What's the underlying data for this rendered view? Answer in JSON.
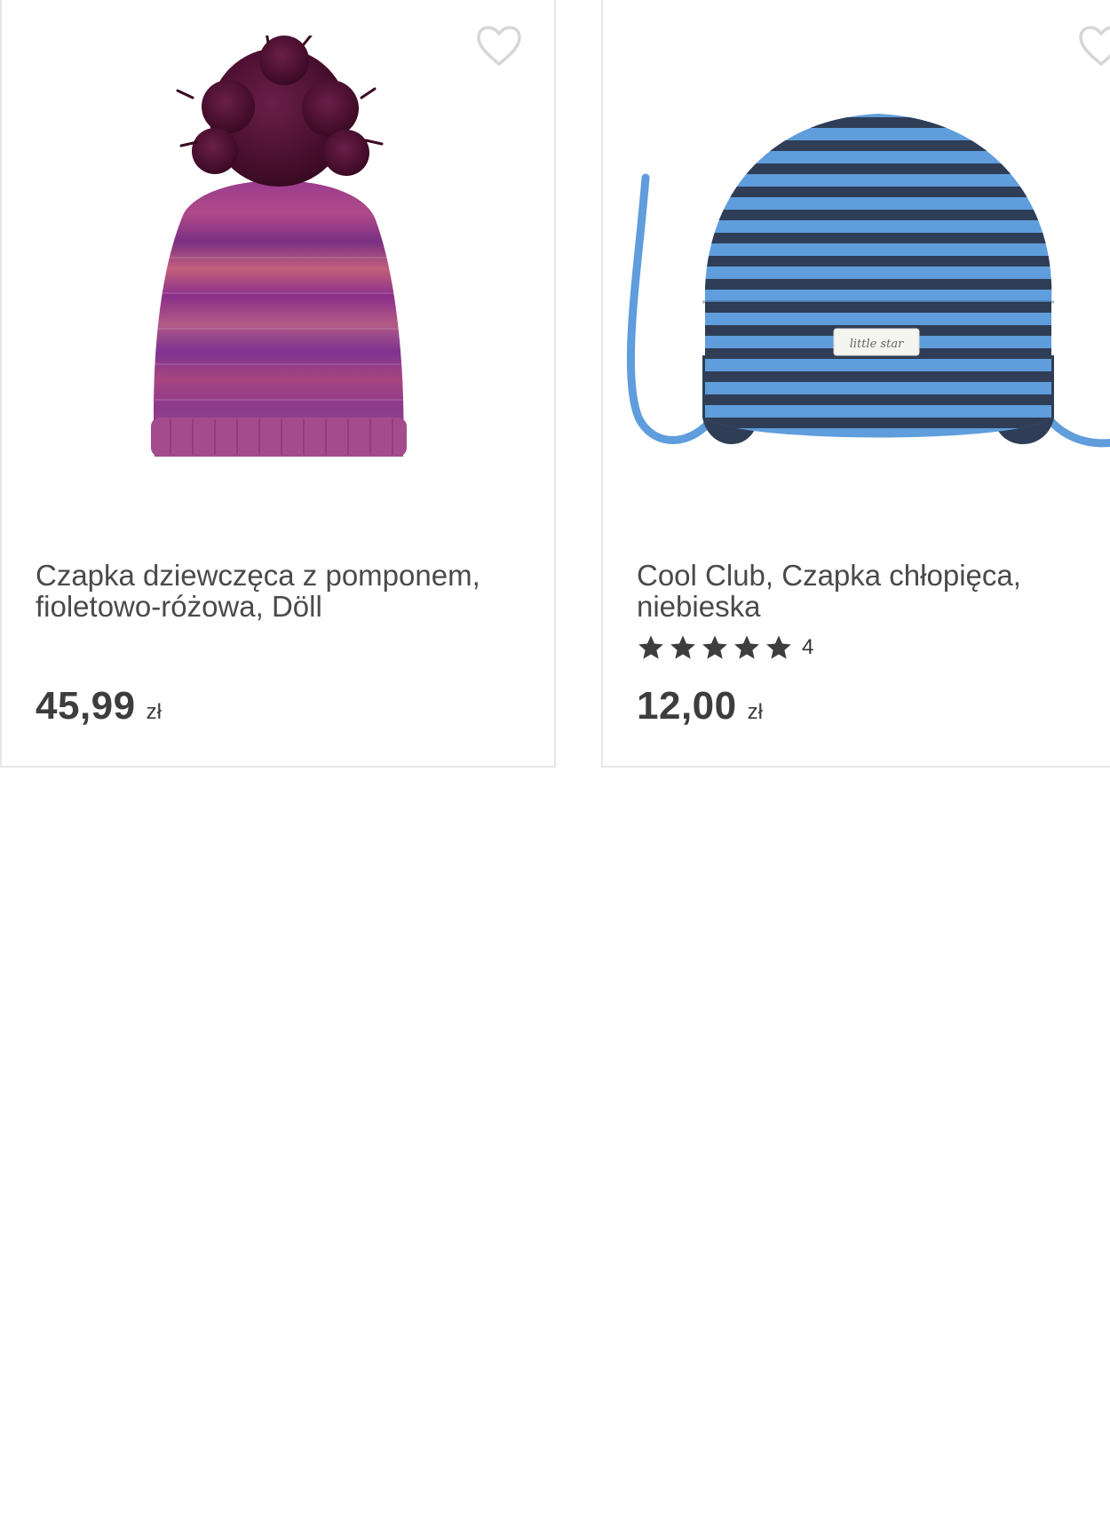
{
  "products": [
    {
      "image_alt": "Czapka dziewczęca z pomponem, fioletowo-różowa, Döll",
      "title_line1": "Czapka dziewczęca z pomponem,",
      "title_line2": "fioletowo-różowa, Döll",
      "price_amount": "45,99",
      "price_currency": "zł",
      "favorite_icon": "heart-outline-icon"
    },
    {
      "image_alt": "Cool Club, Czapka chłopięca, niebieska",
      "title_line1": "Cool Club, Czapka chłopięca,",
      "title_line2": "niebieska",
      "rating_stars": 5,
      "rating_count": "4",
      "price_amount": "12,00",
      "price_currency": "zł",
      "favorite_icon": "heart-outline-icon",
      "hat_label": "little star"
    }
  ],
  "colors": {
    "text": "#4a4a4a",
    "price": "#3d3d3d",
    "star": "#3d3d3d",
    "border": "#e6e6e6",
    "heart_outline": "#d6d6d6"
  }
}
